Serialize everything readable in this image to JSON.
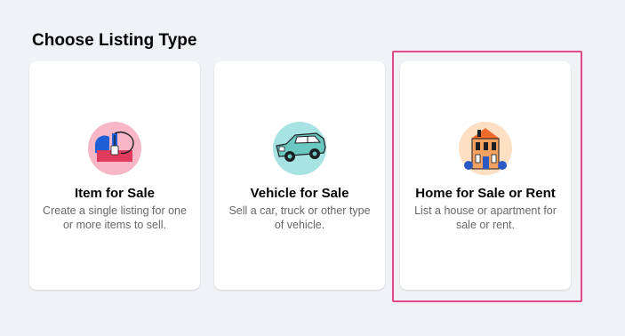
{
  "page": {
    "title": "Choose Listing Type"
  },
  "cards": [
    {
      "title": "Item for Sale",
      "description": "Create a single listing for one or more items to sell.",
      "icon": "price-tag-bag-icon"
    },
    {
      "title": "Vehicle for Sale",
      "description": "Sell a car, truck or other type of vehicle.",
      "icon": "car-icon"
    },
    {
      "title": "Home for Sale or Rent",
      "description": "List a house or apartment for sale or rent.",
      "icon": "house-icon"
    }
  ],
  "colors": {
    "background": "#f0f2f5",
    "card": "#ffffff",
    "highlight": "#e3498c"
  }
}
